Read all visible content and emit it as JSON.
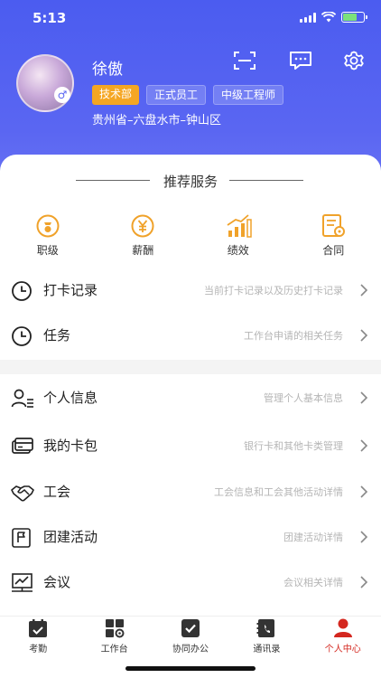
{
  "status_bar": {
    "time": "5:13"
  },
  "profile": {
    "name": "徐傲",
    "tags": [
      "技术部",
      "正式员工",
      "中级工程师"
    ],
    "location": "贵州省–六盘水市–钟山区",
    "gender_symbol": "♂"
  },
  "services": {
    "title": "推荐服务",
    "items": [
      {
        "label": "职级",
        "icon": "rank-icon"
      },
      {
        "label": "薪酬",
        "icon": "salary-icon"
      },
      {
        "label": "绩效",
        "icon": "performance-icon"
      },
      {
        "label": "合同",
        "icon": "contract-icon"
      }
    ]
  },
  "menu": [
    {
      "title": "打卡记录",
      "desc": "当前打卡记录以及历史打卡记录",
      "icon": "clock-icon"
    },
    {
      "title": "任务",
      "desc": "工作台申请的相关任务",
      "icon": "clock-icon"
    },
    {
      "title": "个人信息",
      "desc": "管理个人基本信息",
      "icon": "person-list-icon"
    },
    {
      "title": "我的卡包",
      "desc": "银行卡和其他卡类管理",
      "icon": "card-wallet-icon"
    },
    {
      "title": "工会",
      "desc": "工会信息和工会其他活动详情",
      "icon": "handshake-icon"
    },
    {
      "title": "团建活动",
      "desc": "团建活动详情",
      "icon": "flag-icon"
    },
    {
      "title": "会议",
      "desc": "会议相关详情",
      "icon": "meeting-board-icon"
    }
  ],
  "tabbar": [
    {
      "label": "考勤",
      "active": false
    },
    {
      "label": "工作台",
      "active": false
    },
    {
      "label": "协同办公",
      "active": false
    },
    {
      "label": "通讯录",
      "active": false
    },
    {
      "label": "个人中心",
      "active": true
    }
  ],
  "colors": {
    "header": "#4b5cf0",
    "accent_orange": "#f5a623",
    "active_tab": "#d4271f"
  }
}
